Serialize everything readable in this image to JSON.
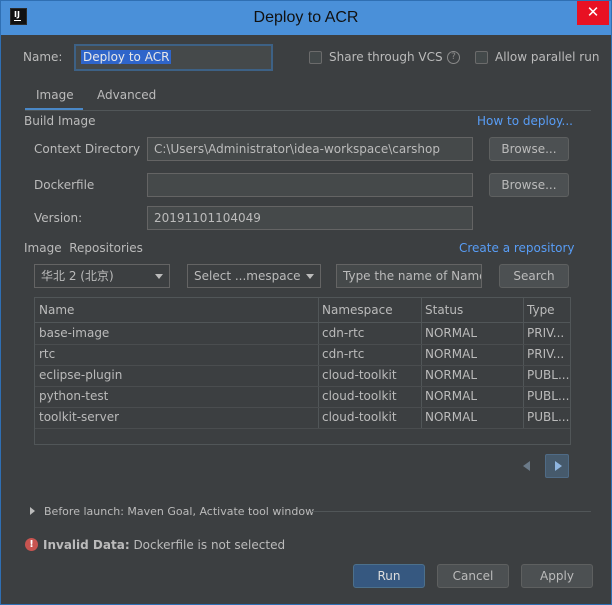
{
  "window": {
    "title": "Deploy to ACR",
    "app_icon": "IJ",
    "close_glyph": "✕"
  },
  "header": {
    "name_label": "Name:",
    "name_value": "Deploy to ACR",
    "share_vcs_label": "Share through VCS",
    "help_glyph": "?",
    "allow_parallel_label": "Allow parallel run"
  },
  "tabs": [
    {
      "label": "Image",
      "selected": true
    },
    {
      "label": "Advanced",
      "selected": false
    }
  ],
  "build_image": {
    "section_label": "Build Image",
    "help_link": "How to deploy...",
    "context_dir_label": "Context Directory",
    "context_dir_value": "C:\\Users\\Administrator\\idea-workspace\\carshop",
    "dockerfile_label": "Dockerfile",
    "dockerfile_value": "",
    "version_label": "Version:",
    "version_value": "20191101104049",
    "browse_label": "Browse..."
  },
  "repositories": {
    "section_label": "Image  Repositories",
    "create_link": "Create a repository",
    "region_value": "华北 2 (北京)",
    "namespace_value": "Select ...mespace",
    "search_placeholder": "Type the name of Namespace",
    "search_button": "Search",
    "columns": [
      "Name",
      "Namespace",
      "Status",
      "Type"
    ],
    "rows": [
      {
        "name": "base-image",
        "namespace": "cdn-rtc",
        "status": "NORMAL",
        "type": "PRIV..."
      },
      {
        "name": "rtc",
        "namespace": "cdn-rtc",
        "status": "NORMAL",
        "type": "PRIV..."
      },
      {
        "name": "eclipse-plugin",
        "namespace": "cloud-toolkit",
        "status": "NORMAL",
        "type": "PUBL..."
      },
      {
        "name": "python-test",
        "namespace": "cloud-toolkit",
        "status": "NORMAL",
        "type": "PUBL..."
      },
      {
        "name": "toolkit-server",
        "namespace": "cloud-toolkit",
        "status": "NORMAL",
        "type": "PUBL..."
      }
    ]
  },
  "before_launch": {
    "label": "Before launch: Maven Goal, Activate tool window"
  },
  "error": {
    "glyph": "!",
    "title": "Invalid Data:",
    "message": " Dockerfile is not selected"
  },
  "footer": {
    "run": "Run",
    "cancel": "Cancel",
    "apply": "Apply"
  },
  "colors": {
    "titlebar": "#4a90d9",
    "background": "#3c3f41",
    "link": "#589df6",
    "primary_button": "#365880",
    "error": "#c75450"
  }
}
